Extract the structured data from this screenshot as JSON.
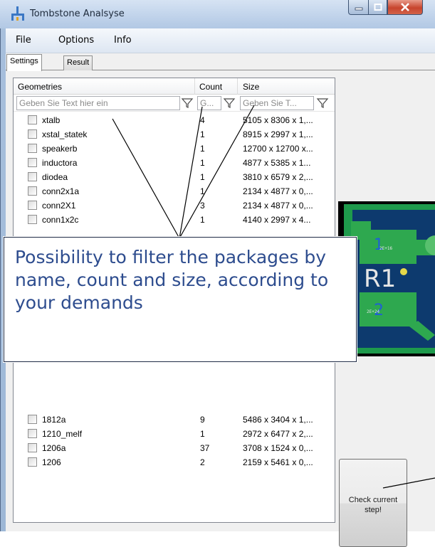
{
  "window": {
    "title": "Tombstone Analsyse",
    "controls": {
      "minimize": "minimize",
      "maximize": "maximize",
      "close": "close"
    }
  },
  "menu": [
    "File",
    "Options",
    "Info"
  ],
  "tabs": [
    {
      "label": "Settings",
      "active": true
    },
    {
      "label": "Result",
      "active": false
    }
  ],
  "grid": {
    "columns": [
      "Geometries",
      "Count",
      "Size"
    ],
    "filters": {
      "name_placeholder": "Geben Sie Text hier ein",
      "count_placeholder": "G...",
      "size_placeholder": "Geben Sie T..."
    },
    "rows_top": [
      {
        "name": "xtalb",
        "count": "4",
        "size": "5105 x 8306 x 1,..."
      },
      {
        "name": "xstal_statek",
        "count": "1",
        "size": "8915 x 2997 x 1,..."
      },
      {
        "name": "speakerb",
        "count": "1",
        "size": "12700 x 12700 x..."
      },
      {
        "name": "inductora",
        "count": "1",
        "size": "4877 x 5385 x 1..."
      },
      {
        "name": "diodea",
        "count": "1",
        "size": "3810 x 6579 x 2,..."
      },
      {
        "name": "conn2x1a",
        "count": "1",
        "size": "2134 x 4877 x 0,..."
      },
      {
        "name": "conn2X1",
        "count": "3",
        "size": "2134 x 4877 x 0,..."
      },
      {
        "name": "conn1x2c",
        "count": "1",
        "size": "4140 x 2997 x 4..."
      }
    ],
    "rows_bottom": [
      {
        "name": "1812a",
        "count": "9",
        "size": "5486 x 3404 x 1,..."
      },
      {
        "name": "1210_melf",
        "count": "1",
        "size": "2972 x 6477 x 2,..."
      },
      {
        "name": "1206a",
        "count": "37",
        "size": "3708 x 1524 x 0,..."
      },
      {
        "name": "1206",
        "count": "2",
        "size": "2159 x 5461 x 0,..."
      }
    ]
  },
  "preview": {
    "pad_top_label": "1",
    "pad_bottom_label": "2",
    "designator": "R1",
    "small_text_top": "2E+16",
    "small_text_bottom": "2E+24",
    "colors": {
      "copper": "#2ea84f",
      "body": "#1e9a4c",
      "designator": "#e6e6e6",
      "pad_number": "#1f5fd6",
      "pin": "#e5d84a"
    }
  },
  "check_button": {
    "label": "Check current step!"
  },
  "annotation": {
    "text": "Possibility to filter the packages by name, count and size, according to your demands"
  },
  "colors": {
    "accent_text": "#2d4c8e"
  }
}
